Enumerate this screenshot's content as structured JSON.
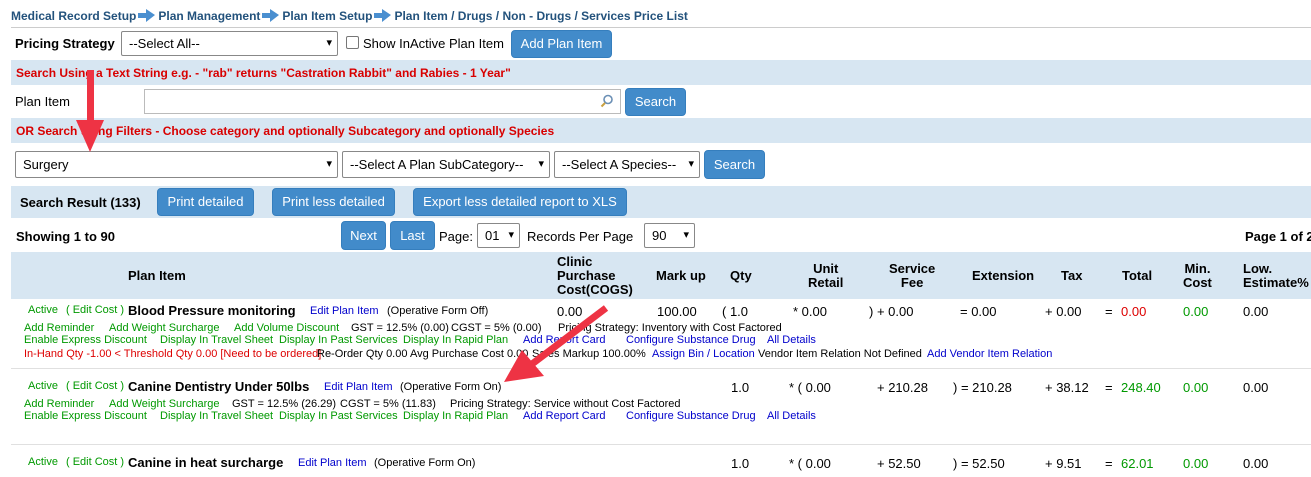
{
  "breadcrumb": [
    "Medical Record Setup",
    "Plan Management",
    "Plan Item Setup",
    "Plan Item / Drugs / Non - Drugs / Services Price List"
  ],
  "pricing": {
    "label": "Pricing Strategy",
    "select": "--Select All--",
    "show_inactive": "Show InActive Plan Item",
    "add": "Add Plan Item"
  },
  "text_search": {
    "hint": "Search Using a Text String e.g. - \"rab\" returns \"Castration Rabbit\" and Rabies - 1 Year\"",
    "label": "Plan Item",
    "value": "",
    "button": "Search"
  },
  "filter_search": {
    "hint": "OR Search using Filters - Choose category and optionally Subcategory and optionally Species",
    "category": "Surgery",
    "subcategory": "--Select A Plan SubCategory--",
    "species": "--Select A Species--",
    "button": "Search"
  },
  "result_bar": {
    "label": "Search Result (133)",
    "print_detailed": "Print detailed",
    "print_less": "Print less detailed",
    "export": "Export less detailed report to XLS"
  },
  "paging": {
    "showing": "Showing 1 to 90",
    "next": "Next",
    "last": "Last",
    "page_label": "Page:",
    "page": "01",
    "records_label": "Records Per Page",
    "records": "90",
    "page_of": "Page 1 of 2"
  },
  "columns": {
    "plan_item": "Plan Item",
    "cogs": [
      "Clinic",
      "Purchase",
      "Cost(COGS)"
    ],
    "markup": "Mark up",
    "qty": "Qty",
    "unit_retail": [
      "Unit",
      "Retail"
    ],
    "service_fee": [
      "Service",
      "Fee"
    ],
    "extension": "Extension",
    "tax": "Tax",
    "total": "Total",
    "min_cost": [
      "Min.",
      "Cost"
    ],
    "low_estimate": [
      "Low.",
      "Estimate%"
    ]
  },
  "rows": [
    {
      "status": "Active",
      "edit_cost": "( Edit Cost )",
      "name": "Blood Pressure monitoring",
      "edit_plan": "Edit Plan Item",
      "form": "(Operative Form Off)",
      "cogs": "0.00",
      "markup": "100.00",
      "qty": "( 1.0",
      "unit_retail": "* 0.00",
      "service_fee": ") + 0.00",
      "extension": "= 0.00",
      "tax": "+ 0.00",
      "eq": "=",
      "total": "0.00",
      "min_cost": "0.00",
      "low_estimate": "0.00",
      "line1": {
        "add_reminder": "Add Reminder",
        "weight": "Add Weight Surcharge",
        "volume": "Add Volume Discount",
        "gst": "GST = 12.5% (0.00)",
        "cgst": "CGST = 5% (0.00)",
        "pricing": "Pricing Strategy: Inventory with Cost Factored"
      },
      "line2": {
        "express": "Enable Express Discount",
        "travel": "Display In Travel Sheet",
        "past": "Display In Past Services",
        "rapid": "Display In Rapid Plan",
        "report": "Add Report Card",
        "substance": "Configure Substance Drug",
        "details": "All Details"
      },
      "line3": {
        "inhand": "In-Hand Qty -1.00 < Threshold Qty 0.00 [Need to be ordered]",
        "reorder": "Re-Order Qty 0.00",
        "avg": "Avg Purchase Cost 0.00",
        "sales": "Sales Markup 100.00%",
        "bin": "Assign Bin / Location",
        "vendor": "Vendor Item Relation Not Defined",
        "add_vendor": "Add Vendor Item Relation"
      }
    },
    {
      "status": "Active",
      "edit_cost": "( Edit Cost )",
      "name": "Canine Dentistry Under 50lbs",
      "edit_plan": "Edit Plan Item",
      "form": "(Operative Form On)",
      "qty": "1.0",
      "unit_retail": "* ( 0.00",
      "service_fee": "+ 210.28",
      "extension": ") = 210.28",
      "tax": "+ 38.12",
      "eq": "=",
      "total": "248.40",
      "min_cost": "0.00",
      "low_estimate": "0.00",
      "line1": {
        "add_reminder": "Add Reminder",
        "weight": "Add Weight Surcharge",
        "gst": "GST = 12.5% (26.29)",
        "cgst": "CGST = 5% (11.83)",
        "pricing": "Pricing Strategy: Service without Cost Factored"
      },
      "line2": {
        "express": "Enable Express Discount",
        "travel": "Display In Travel Sheet",
        "past": "Display In Past Services",
        "rapid": "Display In Rapid Plan",
        "report": "Add Report Card",
        "substance": "Configure Substance Drug",
        "details": "All Details"
      }
    },
    {
      "status": "Active",
      "edit_cost": "( Edit Cost )",
      "name": "Canine in heat surcharge",
      "edit_plan": "Edit Plan Item",
      "form": "(Operative Form On)",
      "qty": "1.0",
      "unit_retail": "* ( 0.00",
      "service_fee": "+ 52.50",
      "extension": ") = 52.50",
      "tax": "+ 9.51",
      "eq": "=",
      "total": "62.01",
      "min_cost": "0.00",
      "low_estimate": "0.00"
    }
  ],
  "colors": {
    "link": "#0000cc",
    "active_green": "#009900",
    "alert_red": "#d80000",
    "button": "#428bca",
    "bar": "#d7e6f2",
    "annotation_arrow": "#ee3344"
  }
}
